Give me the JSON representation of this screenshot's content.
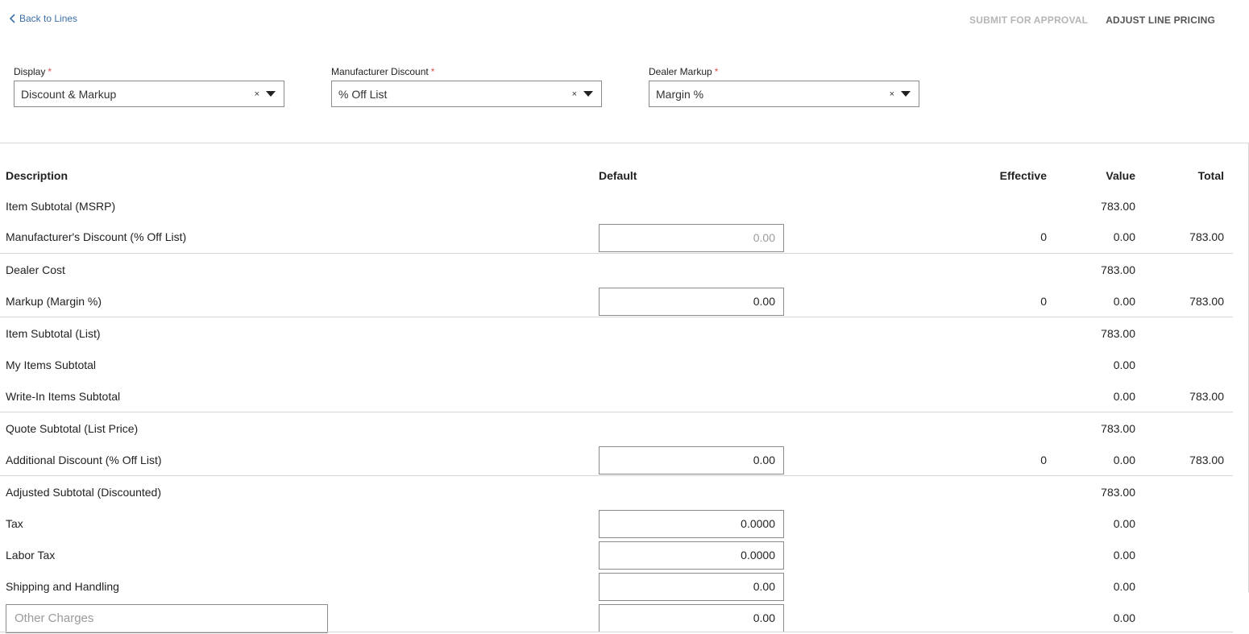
{
  "header": {
    "back_label": "Back to Lines",
    "submit_label": "SUBMIT FOR APPROVAL",
    "adjust_label": "ADJUST LINE PRICING"
  },
  "filters": {
    "display": {
      "label": "Display",
      "value": "Discount & Markup"
    },
    "manufacturer_discount": {
      "label": "Manufacturer Discount",
      "value": "% Off List"
    },
    "dealer_markup": {
      "label": "Dealer Markup",
      "value": "Margin %"
    }
  },
  "table": {
    "headers": {
      "description": "Description",
      "default": "Default",
      "effective": "Effective",
      "value": "Value",
      "total": "Total"
    },
    "rows": [
      {
        "description": "Item Subtotal (MSRP)",
        "default": "",
        "effective": "",
        "value": "783.00",
        "total": ""
      },
      {
        "description": "Manufacturer's Discount (% Off List)",
        "default": "0.00",
        "effective": "0",
        "value": "0.00",
        "total": "783.00"
      },
      {
        "description": "Dealer Cost",
        "default": "",
        "effective": "",
        "value": "783.00",
        "total": ""
      },
      {
        "description": "Markup (Margin %)",
        "default": "0.00",
        "effective": "0",
        "value": "0.00",
        "total": "783.00"
      },
      {
        "description": "Item Subtotal (List)",
        "default": "",
        "effective": "",
        "value": "783.00",
        "total": ""
      },
      {
        "description": "My Items Subtotal",
        "default": "",
        "effective": "",
        "value": "0.00",
        "total": ""
      },
      {
        "description": "Write-In Items Subtotal",
        "default": "",
        "effective": "",
        "value": "0.00",
        "total": "783.00"
      },
      {
        "description": "Quote Subtotal (List Price)",
        "default": "",
        "effective": "",
        "value": "783.00",
        "total": ""
      },
      {
        "description": "Additional Discount (% Off List)",
        "default": "0.00",
        "effective": "0",
        "value": "0.00",
        "total": "783.00"
      },
      {
        "description": "Adjusted Subtotal (Discounted)",
        "default": "",
        "effective": "",
        "value": "783.00",
        "total": ""
      },
      {
        "description": "Tax",
        "default": "0.0000",
        "effective": "",
        "value": "0.00",
        "total": ""
      },
      {
        "description": "Labor Tax",
        "default": "0.0000",
        "effective": "",
        "value": "0.00",
        "total": ""
      },
      {
        "description": "Shipping and Handling",
        "default": "0.00",
        "effective": "",
        "value": "0.00",
        "total": ""
      },
      {
        "description_placeholder": "Other Charges",
        "default": "0.00",
        "effective": "",
        "value": "0.00",
        "total": ""
      }
    ]
  },
  "colors": {
    "link": "#3a6fa8",
    "required": "#d9534f",
    "disabled": "#b5b5b5"
  },
  "icons": {
    "back": "chevron-left-icon",
    "clear": "clear-x-icon",
    "caret": "caret-down-icon"
  }
}
